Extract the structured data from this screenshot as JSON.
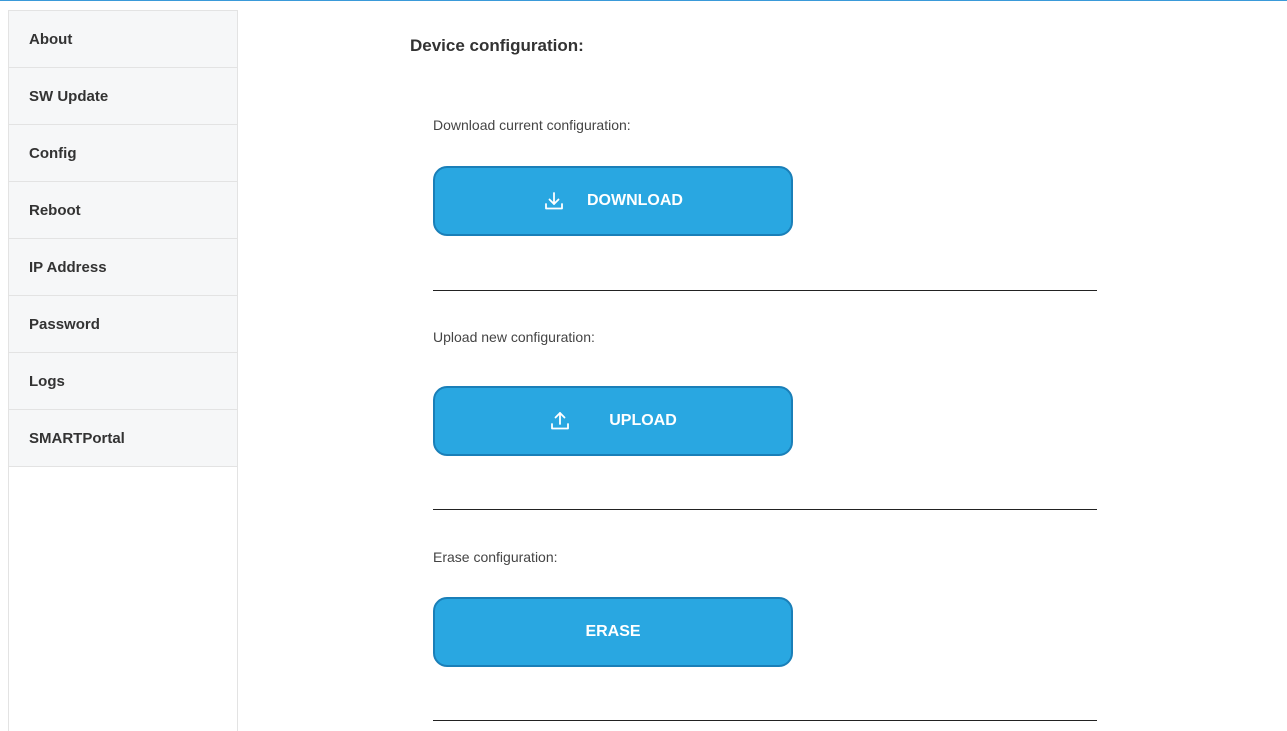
{
  "sidebar": {
    "items": [
      {
        "label": "About"
      },
      {
        "label": "SW Update"
      },
      {
        "label": "Config"
      },
      {
        "label": "Reboot"
      },
      {
        "label": "IP Address"
      },
      {
        "label": "Password"
      },
      {
        "label": "Logs"
      },
      {
        "label": "SMARTPortal"
      }
    ]
  },
  "main": {
    "title": "Device configuration:",
    "download": {
      "label": "Download current configuration:",
      "button": "DOWNLOAD",
      "icon": "download-icon"
    },
    "upload": {
      "label": "Upload new configuration:",
      "button": "UPLOAD",
      "icon": "upload-icon"
    },
    "erase": {
      "label": "Erase configuration:",
      "button": "ERASE"
    }
  },
  "colors": {
    "accent": "#29a7e1",
    "button_border": "#1a7fb8",
    "sidebar_bg": "#f6f7f8",
    "top_line": "#3a9ad9"
  }
}
